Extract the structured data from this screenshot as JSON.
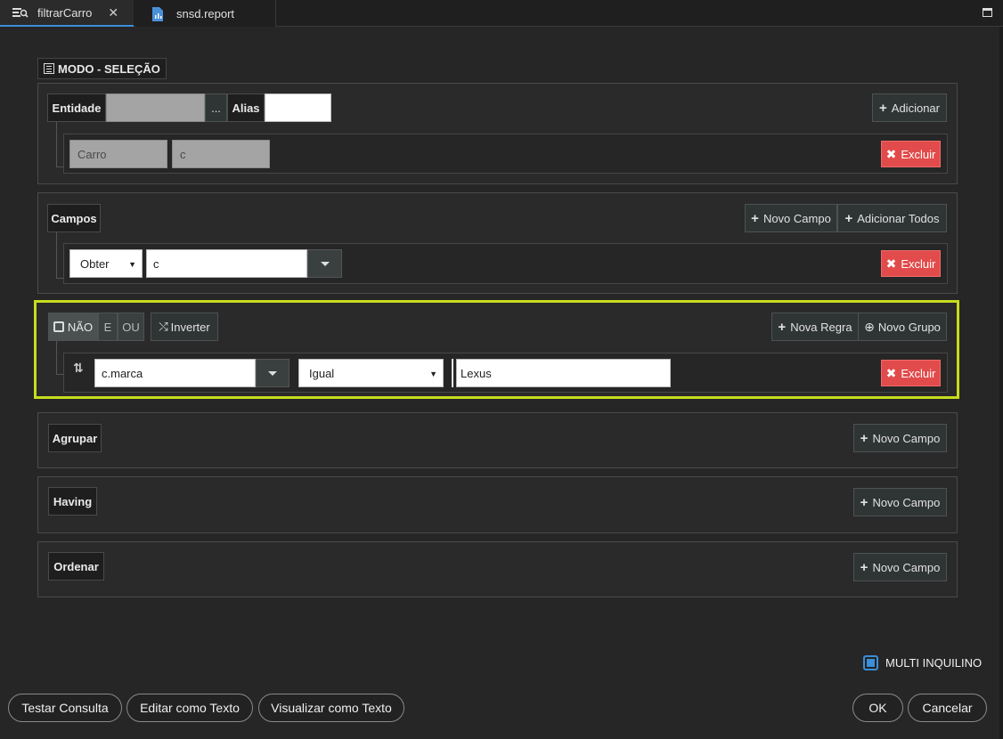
{
  "tabs": [
    {
      "label": "filtrarCarro",
      "close": "✕"
    },
    {
      "label": "snsd.report"
    }
  ],
  "mode_label": "MODO - SELEÇÃO",
  "entity_section": {
    "entidade_label": "Entidade",
    "entidade_value": "",
    "browse_label": "...",
    "alias_label": "Alias",
    "alias_value": "",
    "add_label": "Adicionar",
    "row": {
      "entity": "Carro",
      "alias": "c",
      "delete_label": "Excluir"
    }
  },
  "fields_section": {
    "label": "Campos",
    "new_field_label": "Novo Campo",
    "add_all_label": "Adicionar Todos",
    "row": {
      "mode": "Obter",
      "value": "c",
      "delete_label": "Excluir"
    }
  },
  "where_section": {
    "not_label": "NÃO",
    "and_label": "E",
    "or_label": "OU",
    "invert_label": "Inverter",
    "new_rule_label": "Nova Regra",
    "new_group_label": "Novo Grupo",
    "rule": {
      "field": "c.marca",
      "operator": "Igual",
      "value": "Lexus",
      "delete_label": "Excluir"
    }
  },
  "group_section": {
    "label": "Agrupar",
    "new_field_label": "Novo Campo"
  },
  "having_section": {
    "label": "Having",
    "new_field_label": "Novo Campo"
  },
  "order_section": {
    "label": "Ordenar",
    "new_field_label": "Novo Campo"
  },
  "multi_inquilino": {
    "label": "MULTI INQUILINO",
    "checked": true
  },
  "footer": {
    "test_label": "Testar Consulta",
    "edit_text_label": "Editar como Texto",
    "view_text_label": "Visualizar como Texto",
    "ok_label": "OK",
    "cancel_label": "Cancelar"
  },
  "colors": {
    "accent": "#3b8ed8",
    "danger": "#e24b4b",
    "highlight": "#c6dc1e"
  }
}
